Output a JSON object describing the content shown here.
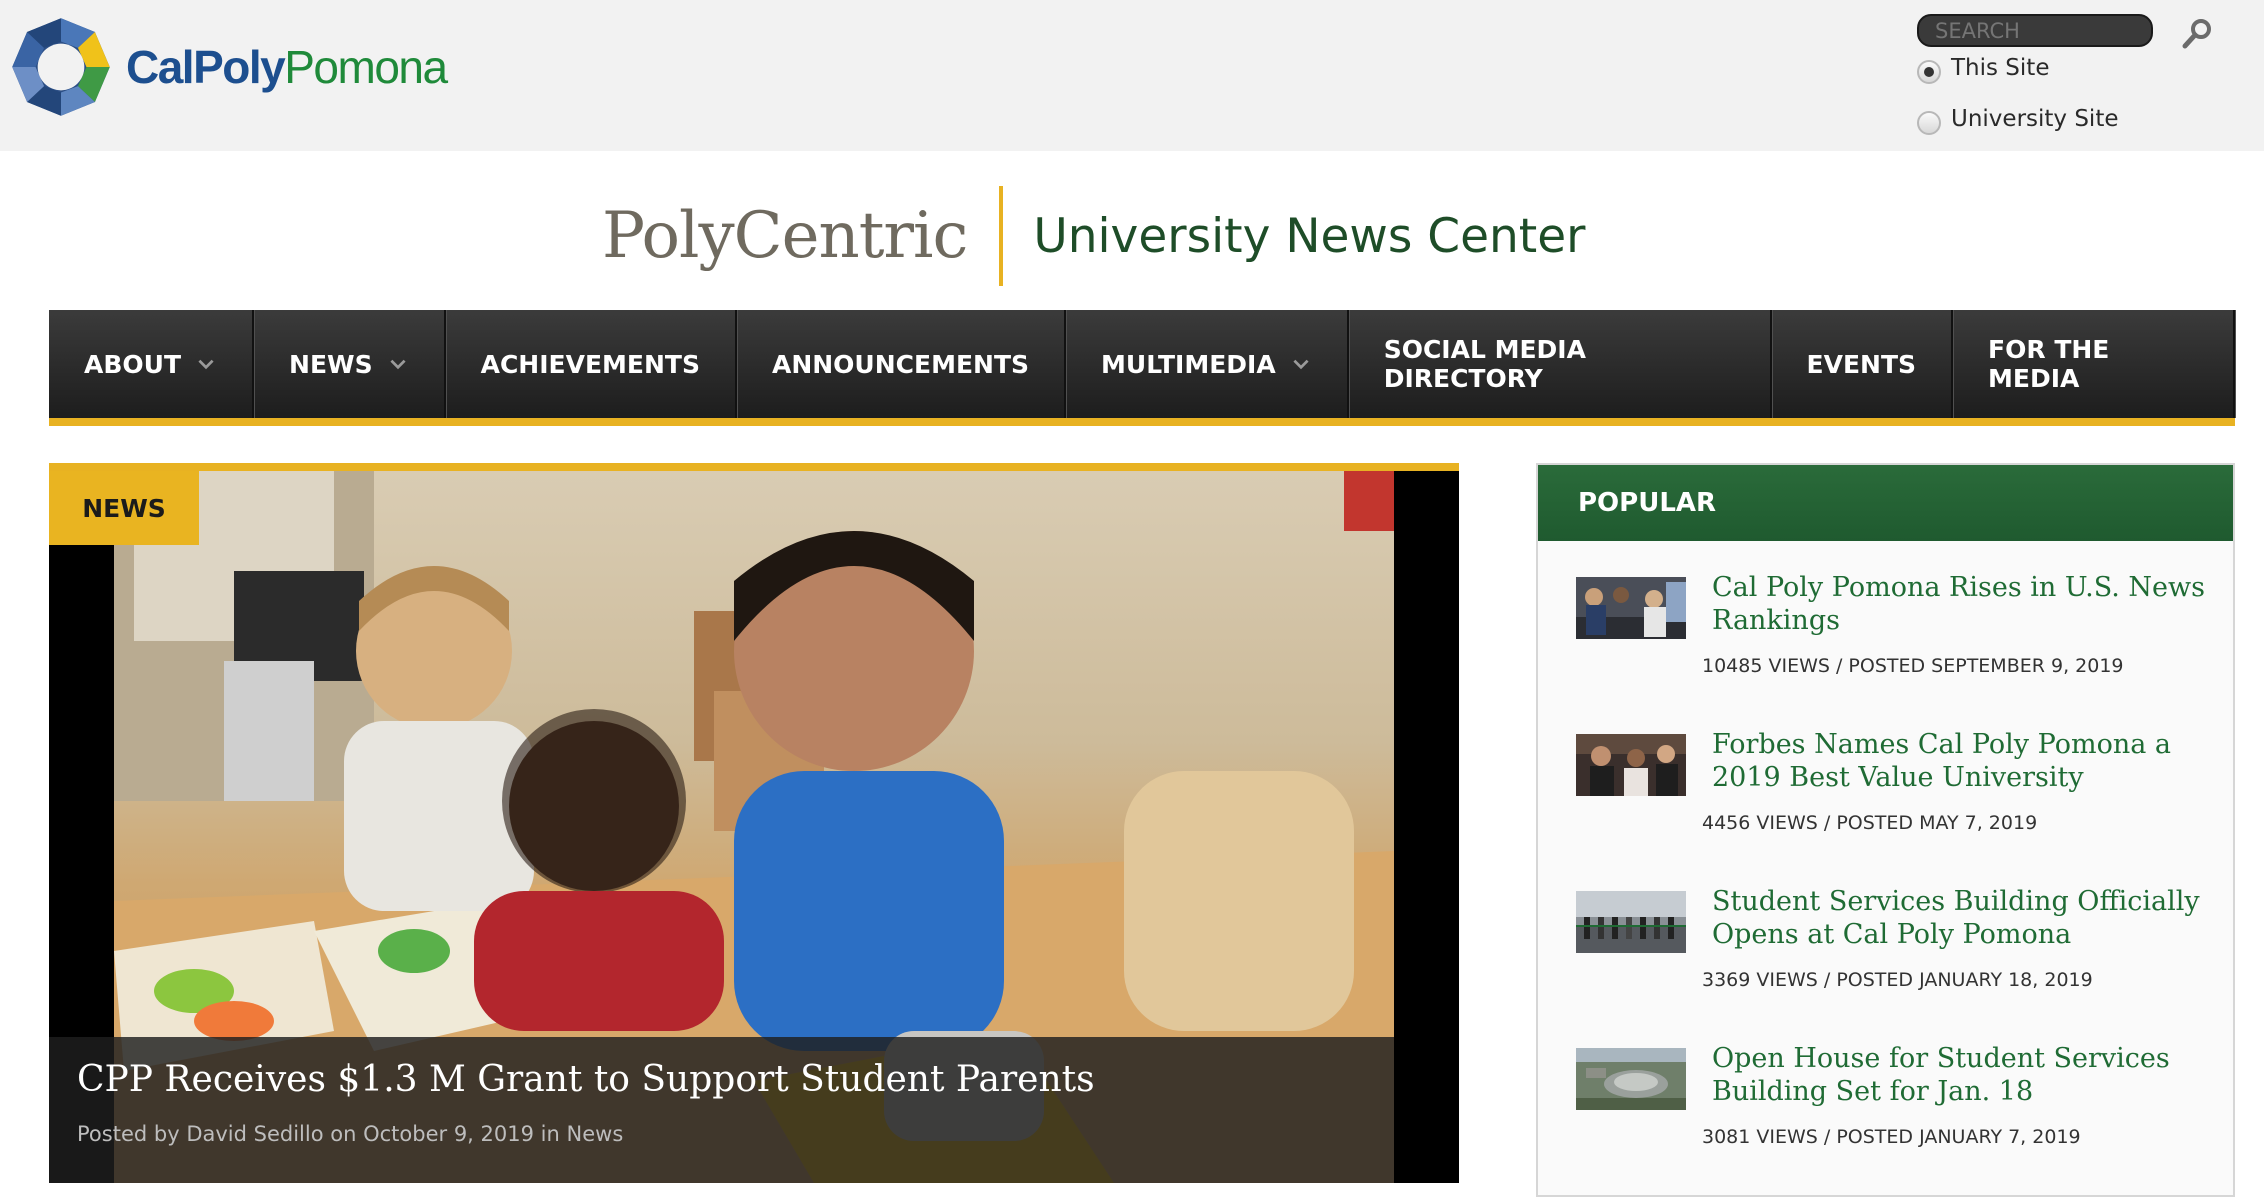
{
  "header": {
    "logo": {
      "part1": "CalPoly",
      "part2": "Pomona",
      "icon": "calpolypomona-octagon-logo-icon"
    },
    "search": {
      "placeholder": "SEARCH",
      "button_icon": "search-icon"
    },
    "scope_options": [
      {
        "label": "This Site",
        "checked": true
      },
      {
        "label": "University Site",
        "checked": false
      }
    ]
  },
  "site_title": {
    "name": "PolyCentric",
    "tagline": "University News Center"
  },
  "nav": {
    "items": [
      {
        "label": "ABOUT",
        "dropdown": true
      },
      {
        "label": "NEWS",
        "dropdown": true
      },
      {
        "label": "ACHIEVEMENTS",
        "dropdown": false
      },
      {
        "label": "ANNOUNCEMENTS",
        "dropdown": false
      },
      {
        "label": "MULTIMEDIA",
        "dropdown": true
      },
      {
        "label": "SOCIAL MEDIA DIRECTORY",
        "dropdown": false
      },
      {
        "label": "EVENTS",
        "dropdown": false
      },
      {
        "label": "FOR THE MEDIA",
        "dropdown": false
      }
    ]
  },
  "featured": {
    "category": "NEWS",
    "headline": "CPP Receives $1.3 M Grant to Support Student Parents",
    "posted_by_prefix": "Posted by",
    "author": "David Sedillo",
    "on_text": "on",
    "date": "October 9, 2019",
    "in_text": "in",
    "section": "News"
  },
  "popular": {
    "heading": "POPULAR",
    "items": [
      {
        "title": "Cal Poly Pomona Rises in U.S. News Rankings",
        "meta": "10485 VIEWS / POSTED SEPTEMBER 9, 2019"
      },
      {
        "title": "Forbes Names Cal Poly Pomona a 2019 Best Value University",
        "meta": "4456 VIEWS / POSTED MAY 7, 2019"
      },
      {
        "title": "Student Services Building Officially Opens at Cal Poly Pomona",
        "meta": "3369 VIEWS / POSTED JANUARY 18, 2019"
      },
      {
        "title": "Open House for Student Services Building Set for Jan. 18",
        "meta": "3081 VIEWS / POSTED JANUARY 7, 2019"
      }
    ]
  },
  "colors": {
    "accent_gold": "#e8b222",
    "brand_green": "#1f6b34",
    "brand_blue": "#1d4f8f",
    "nav_dark": "#2a2a2a"
  }
}
